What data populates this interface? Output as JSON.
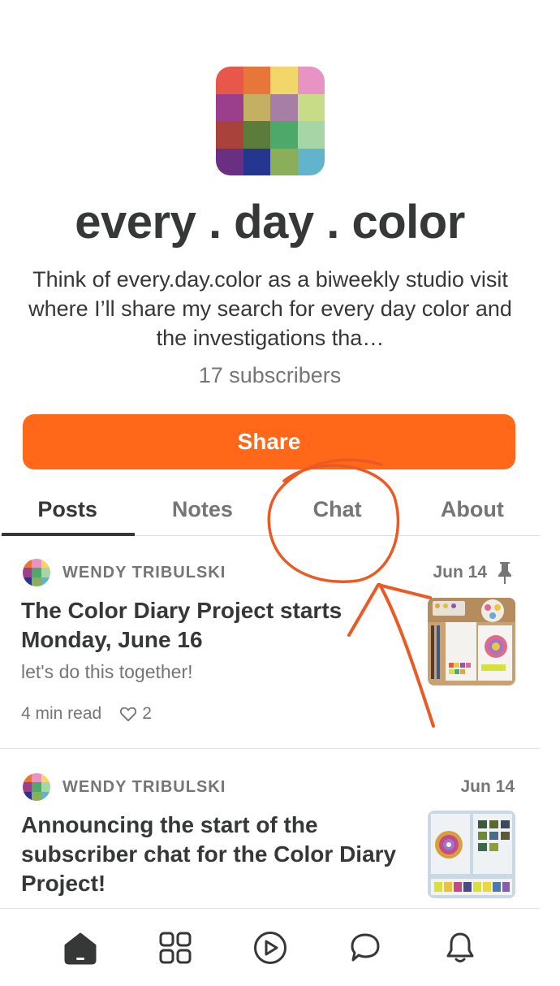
{
  "publication": {
    "title": "every . day . color",
    "description": "Think of every.day.color as a biweekly studio visit where I’ll share my search for every day color and the investigations tha…",
    "subscribers": "17 subscribers",
    "share_label": "Share"
  },
  "tabs": [
    {
      "label": "Posts",
      "active": true
    },
    {
      "label": "Notes",
      "active": false
    },
    {
      "label": "Chat",
      "active": false
    },
    {
      "label": "About",
      "active": false
    }
  ],
  "posts": [
    {
      "author": "WENDY TRIBULSKI",
      "date": "Jun 14",
      "pinned": true,
      "title": "The Color Diary Project starts Monday, June 16",
      "subtitle": "let's do this together!",
      "read_time": "4 min read",
      "likes": "2"
    },
    {
      "author": "WENDY TRIBULSKI",
      "date": "Jun 14",
      "pinned": false,
      "title": "Announcing the start of the subscriber chat for the Color Diary Project!"
    }
  ],
  "nav": [
    "home-icon",
    "grid-icon",
    "play-icon",
    "chat-icon",
    "bell-icon"
  ],
  "colors": {
    "accent": "#ff6719",
    "annotation": "#ec5a24",
    "text_primary": "#363737",
    "text_secondary": "#757575"
  }
}
